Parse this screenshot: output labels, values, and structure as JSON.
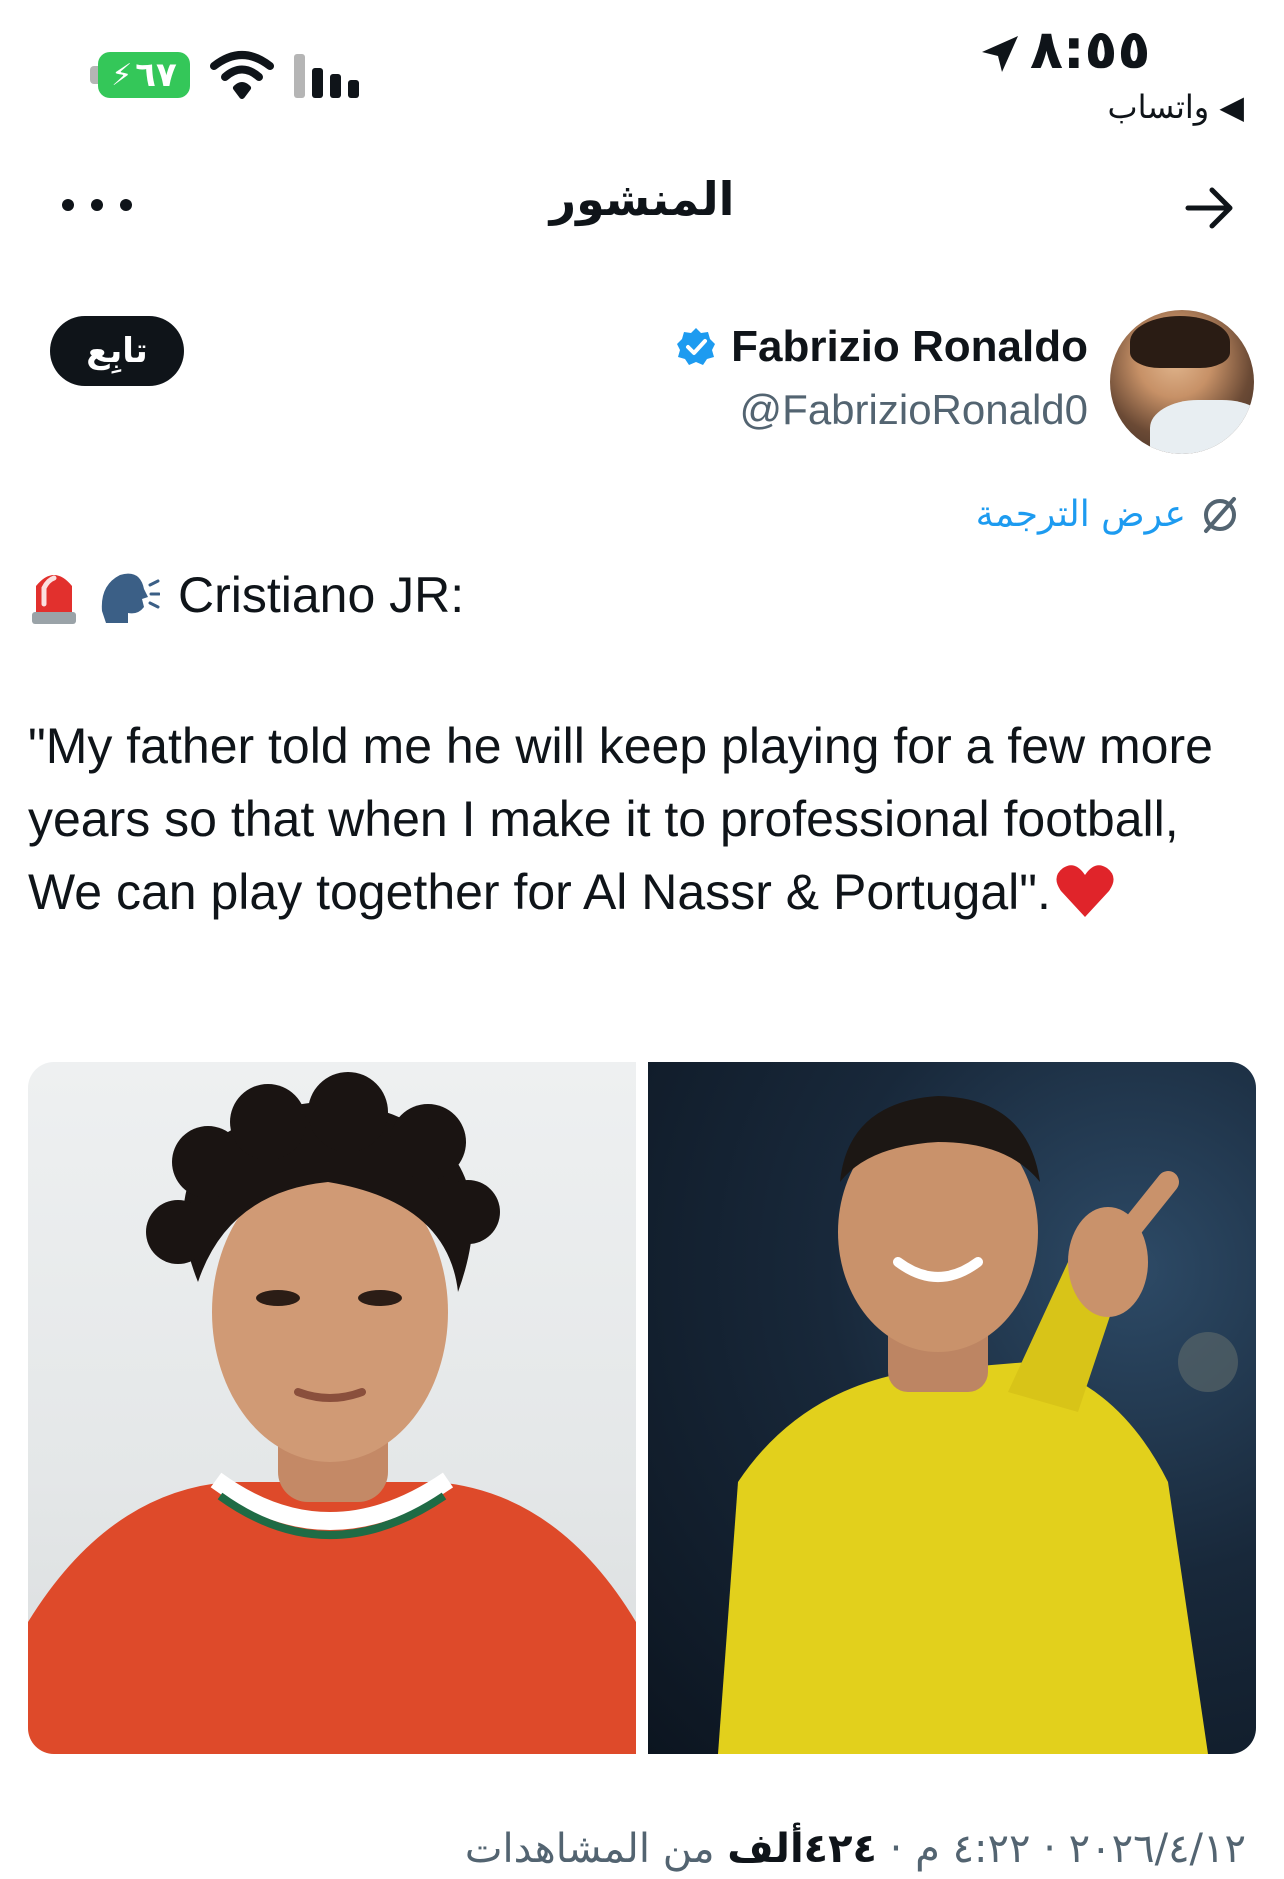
{
  "status_bar": {
    "time": "٨:٥٥",
    "battery": "٦٧",
    "back_app": "◀ واتساب"
  },
  "header": {
    "title": "المنشور"
  },
  "author": {
    "name": "Fabrizio Ronaldo",
    "handle": "@FabrizioRonald0",
    "verified": true,
    "follow_label": "تابِع"
  },
  "translate_label": "عرض الترجمة",
  "tweet": {
    "line1": "Cristiano JR:",
    "quote": "\"My father told me he will keep playing for a few more years so that when I make it to professional football, We can play together for Al Nassr & Portugal\"."
  },
  "meta": {
    "date": "٢٠٢٦/٤/١٢",
    "time": "٤:٢٢ م",
    "views": "٤٢٤ألف",
    "views_label": "من المشاهدات",
    "sep": " · "
  },
  "colors": {
    "accent": "#1d9bf0",
    "text": "#0f1419",
    "secondary": "#536471",
    "battery": "#34c759"
  },
  "icons": [
    "battery-icon",
    "wifi-icon",
    "signal-icon",
    "location-arrow-icon",
    "more-icon",
    "arrow-right-icon",
    "verified-icon",
    "translate-icon",
    "siren-emoji",
    "speaking-head-emoji",
    "heart-emoji"
  ]
}
